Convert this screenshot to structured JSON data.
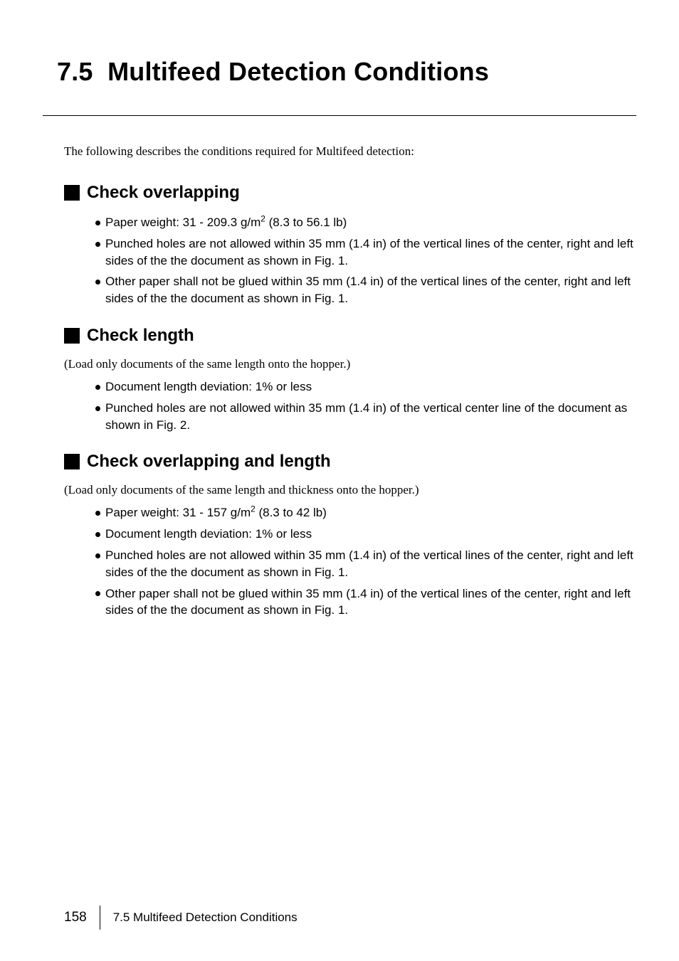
{
  "chapter": {
    "number": "7.5",
    "title": "Multifeed Detection Conditions"
  },
  "intro": "The following describes the conditions required for Multifeed detection:",
  "sections": [
    {
      "heading": "Check overlapping",
      "note": "",
      "bullets": [
        {
          "prefix": "Paper weight: 31 - 209.3 g/m",
          "sup": "2",
          "suffix": " (8.3 to 56.1 lb)"
        },
        {
          "text": "Punched holes are not allowed within 35 mm (1.4 in) of the vertical lines of the center, right and left sides of the the document as shown in Fig. 1."
        },
        {
          "text": "Other paper shall not be glued within 35 mm (1.4 in) of the vertical lines of the center, right and left sides of the the document as shown in Fig. 1."
        }
      ]
    },
    {
      "heading": "Check length",
      "note": "(Load only documents of the same length onto the hopper.)",
      "bullets": [
        {
          "text": "Document length deviation: 1% or less"
        },
        {
          "text": "Punched holes are not allowed within 35 mm (1.4 in) of the vertical center line of the document as shown in Fig. 2."
        }
      ]
    },
    {
      "heading": "Check overlapping and length",
      "note": "(Load only documents of the same length and thickness onto the hopper.)",
      "bullets": [
        {
          "prefix": "Paper weight: 31 - 157 g/m",
          "sup": "2",
          "suffix": " (8.3 to 42 lb)"
        },
        {
          "text": "Document length deviation: 1% or less"
        },
        {
          "text": "Punched holes are not allowed within 35 mm (1.4 in) of the vertical lines of the center, right and left sides of the the document as shown in Fig. 1."
        },
        {
          "text": "Other paper shall not be glued within 35 mm (1.4 in) of the vertical lines of the center, right and left sides of the the document as shown in Fig. 1."
        }
      ]
    }
  ],
  "footer": {
    "page": "158",
    "label": "7.5 Multifeed Detection Conditions"
  }
}
